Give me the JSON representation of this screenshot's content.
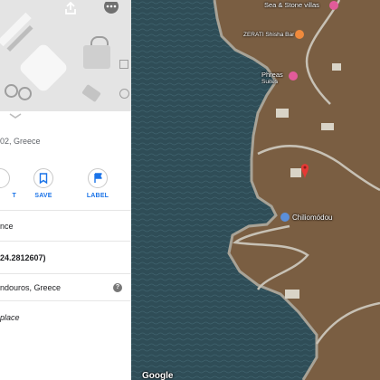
{
  "place": {
    "address_fragment": "02, Greece",
    "plus_code_fragment": "24.2812607)",
    "locality_fragment": "ndouros, Greece",
    "nearby_fragment": "nce",
    "add_place_fragment": "place"
  },
  "actions": {
    "left_fragment": "T",
    "save_label": "SAVE",
    "label_label": "LABEL"
  },
  "help_glyph": "?",
  "map": {
    "pois": {
      "sea_stone": "Sea & Stone villas",
      "zerati": "ZERATI Shisha Bar",
      "phreas_line1": "Phreas",
      "phreas_line2": "Suites",
      "chiliomodou": "Chiliomódou"
    },
    "watermark": "Google"
  },
  "colors": {
    "accent": "#1a73e8",
    "marker": "#e53935",
    "poi_pink": "#e25b9a",
    "poi_orange": "#f08a3c",
    "poi_blue": "#5b8fd9"
  }
}
